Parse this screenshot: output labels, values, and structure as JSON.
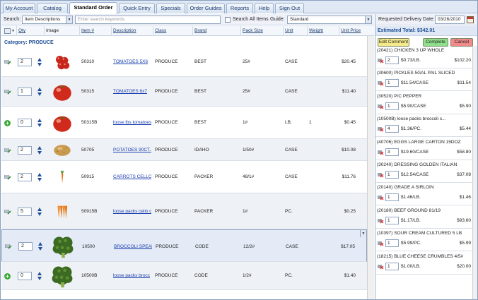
{
  "tabs": [
    "My Account",
    "Catalog",
    "Standard Order",
    "Quick Entry",
    "Specials",
    "Order Guides",
    "Reports",
    "Help",
    "Sign Out"
  ],
  "active_tab": "Standard Order",
  "search": {
    "label": "Search:",
    "field_value": "Item Descriptions",
    "placeholder": "Enter search keywords",
    "all_items_label": "Search All Items",
    "guide_label": "Guide:",
    "guide_value": "Standard"
  },
  "columns": [
    "Qty",
    "Image",
    "Item #",
    "Description",
    "Class",
    "Brand",
    "Pack Size",
    "Unit",
    "Weight",
    "Unit Price"
  ],
  "category": "Category: PRODUCE",
  "rows": [
    {
      "qty": "2",
      "item": "50310",
      "desc": "TOMATOES 5X6",
      "class": "PRODUCE",
      "brand": "BEST",
      "pack": "25#",
      "unit": "CASE",
      "weight": "",
      "price": "$20.45",
      "image": "tomatoes-case",
      "in_cart": true
    },
    {
      "qty": "1",
      "item": "50315",
      "desc": "TOMATOES 6x7",
      "class": "PRODUCE",
      "brand": "BEST",
      "pack": "25#",
      "unit": "CASE",
      "weight": "",
      "price": "$11.40",
      "image": "tomato",
      "in_cart": true
    },
    {
      "qty": "0",
      "item": "50315B",
      "desc": "loose lbs tomatoes",
      "class": "PRODUCE",
      "brand": "BEST",
      "pack": "1#",
      "unit": "LB.",
      "weight": "1",
      "price": "$0.45",
      "image": "tomato",
      "in_cart": false
    },
    {
      "qty": "2",
      "item": "50705",
      "desc": "POTATOES 90CT...",
      "class": "PRODUCE",
      "brand": "IDAHO",
      "pack": "1/50#",
      "unit": "CASE",
      "weight": "",
      "price": "$10.08",
      "image": "potato",
      "in_cart": true
    },
    {
      "qty": "2",
      "item": "50915",
      "desc": "CARROTS CELLO",
      "class": "PRODUCE",
      "brand": "PACKER",
      "pack": "48/1#",
      "unit": "CASE",
      "weight": "",
      "price": "$11.76",
      "image": "carrot",
      "in_cart": true
    },
    {
      "qty": "5",
      "item": "50915B",
      "desc": "loose packs cello c",
      "class": "PRODUCE",
      "brand": "PACKER",
      "pack": "1#",
      "unit": "PC.",
      "weight": "",
      "price": "$0.25",
      "image": "carrots-bunch",
      "in_cart": true
    },
    {
      "qty": "2",
      "item": "10500",
      "desc": "BROCCOLI SPEAR",
      "class": "PRODUCE",
      "brand": "CODE",
      "pack": "12/2#",
      "unit": "CASE",
      "weight": "",
      "price": "$17.05",
      "image": "broccoli",
      "in_cart": true
    },
    {
      "qty": "0",
      "item": "10500B",
      "desc": "loose packs brocc",
      "class": "PRODUCE",
      "brand": "CODE",
      "pack": "1/2#",
      "unit": "PC.",
      "weight": "",
      "price": "$1.40",
      "image": "broccoli",
      "in_cart": false
    }
  ],
  "order": {
    "delivery_label": "Requested Delivery Date:",
    "delivery_date": "03/26/2010",
    "total": "Estimated Total: $342.01",
    "edit_comment": "Edit Comment",
    "complete": "Complete",
    "cancel": "Cancel",
    "items": [
      {
        "name": "(20421) CHICKEN 3 UP WHOLE",
        "qty": "2",
        "price": "$0.73/LB.",
        "ext": "$102.20"
      },
      {
        "name": "(30600) PICKLES 5GAL PAIL SLICED",
        "qty": "1",
        "price": "$11.54/CASE",
        "ext": "$11.54"
      },
      {
        "name": "(30520) P/C PEPPER",
        "qty": "1",
        "price": "$5.90/CASE",
        "ext": "$5.90"
      },
      {
        "name": "(10500B) loose packs broccoli s...",
        "qty": "4",
        "price": "$1.36/PC.",
        "ext": "$5.44"
      },
      {
        "name": "(40706) EGGS LARGE CARTON 15DOZ",
        "qty": "3",
        "price": "$19.60/CASE",
        "ext": "$58.80"
      },
      {
        "name": "(30240) DRESSING GOLDEN ITALIAN",
        "qty": "1",
        "price": "$12.54/CASE",
        "ext": "$37.08"
      },
      {
        "name": "(20140) GRADE A SIRLOIN",
        "qty": "1",
        "price": "$1.46/LB.",
        "ext": "$1.46"
      },
      {
        "name": "(20180) BEEF GROUND 81/19",
        "qty": "1",
        "price": "$1.17/LB.",
        "ext": "$93.60"
      },
      {
        "name": "(10397) SOUR CREAM CULTURED 5 LB",
        "qty": "1",
        "price": "$5.99/PC.",
        "ext": "$5.99"
      },
      {
        "name": "(18215) BLUE CHEESE CRUMBLES 4/5#",
        "qty": "1",
        "price": "$1.00/LB.",
        "ext": "$20.00"
      }
    ]
  },
  "colors": {
    "accent": "#1d4e96",
    "link": "#1a3fb0",
    "stepper": "#1f4f9c",
    "complete": "#8fe08a",
    "cancel": "#f28a8a",
    "edit": "#f6e98a"
  }
}
